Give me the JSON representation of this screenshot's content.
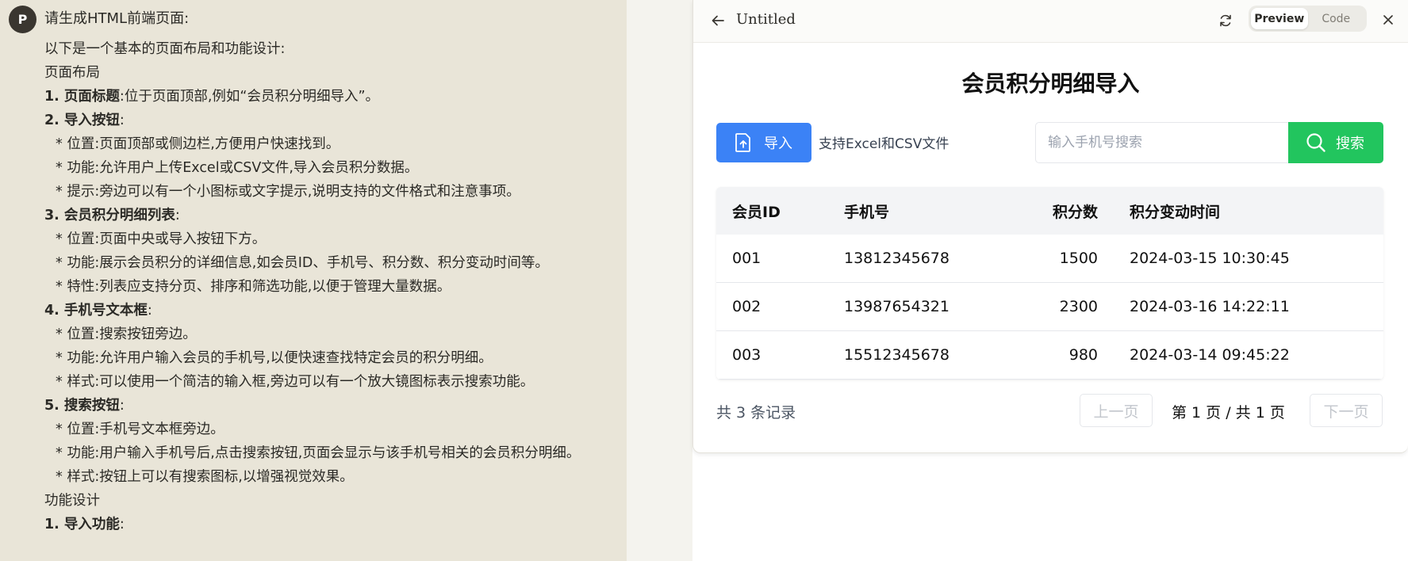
{
  "chat": {
    "avatar": "P",
    "prompt": "请生成HTML前端页面:",
    "lines": [
      {
        "t": "以下是一个基本的页面布局和功能设计:"
      },
      {
        "t": "页面布局"
      },
      {
        "b": "1. 页面标题",
        "t": ":位于页面顶部,例如“会员积分明细导入”。"
      },
      {
        "b": "2. 导入按钮",
        "t": ":"
      },
      {
        "t": "* 位置:页面顶部或侧边栏,方便用户快速找到。",
        "ind": true
      },
      {
        "t": "* 功能:允许用户上传Excel或CSV文件,导入会员积分数据。",
        "ind": true
      },
      {
        "t": "* 提示:旁边可以有一个小图标或文字提示,说明支持的文件格式和注意事项。",
        "ind": true
      },
      {
        "b": "3. 会员积分明细列表",
        "t": ":"
      },
      {
        "t": "* 位置:页面中央或导入按钮下方。",
        "ind": true
      },
      {
        "t": "* 功能:展示会员积分的详细信息,如会员ID、手机号、积分数、积分变动时间等。",
        "ind": true
      },
      {
        "t": "* 特性:列表应支持分页、排序和筛选功能,以便于管理大量数据。",
        "ind": true
      },
      {
        "b": "4. 手机号文本框",
        "t": ":"
      },
      {
        "t": "* 位置:搜索按钮旁边。",
        "ind": true
      },
      {
        "t": "* 功能:允许用户输入会员的手机号,以便快速查找特定会员的积分明细。",
        "ind": true
      },
      {
        "t": "* 样式:可以使用一个简洁的输入框,旁边可以有一个放大镜图标表示搜索功能。",
        "ind": true
      },
      {
        "b": "5. 搜索按钮",
        "t": ":"
      },
      {
        "t": "* 位置:手机号文本框旁边。",
        "ind": true
      },
      {
        "t": "* 功能:用户输入手机号后,点击搜索按钮,页面会显示与该手机号相关的会员积分明细。",
        "ind": true,
        "wrap": true
      },
      {
        "t": "* 样式:按钮上可以有搜索图标,以增强视觉效果。",
        "ind": true
      },
      {
        "t": "功能设计"
      },
      {
        "b": "1. 导入功能",
        "t": ":"
      }
    ]
  },
  "panel": {
    "title": "Untitled",
    "tab_preview": "Preview",
    "tab_code": "Code"
  },
  "app": {
    "heading": "会员积分明细导入",
    "import_label": "导入",
    "import_hint": "支持Excel和CSV文件",
    "search_placeholder": "输入手机号搜索",
    "search_label": "搜索",
    "columns": [
      "会员ID",
      "手机号",
      "积分数",
      "积分变动时间"
    ],
    "rows": [
      [
        "001",
        "13812345678",
        "1500",
        "2024-03-15 10:30:45"
      ],
      [
        "002",
        "13987654321",
        "2300",
        "2024-03-16 14:22:11"
      ],
      [
        "003",
        "15512345678",
        "980",
        "2024-03-14 09:45:22"
      ]
    ],
    "total": "共 3 条记录",
    "prev": "上一页",
    "next": "下一页",
    "page_info": "第 1 页 / 共 1 页"
  },
  "colors": {
    "chat_bg": "#e9e5d8",
    "import_blue": "#3b82f6",
    "search_green": "#22c55e"
  }
}
